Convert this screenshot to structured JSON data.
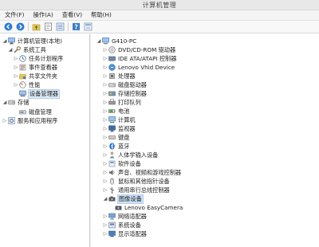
{
  "window": {
    "title": "计算机管理"
  },
  "menu": [
    "文件(F)",
    "操作(A)",
    "查看(V)",
    "帮助(H)"
  ],
  "toolbar": [
    "back-icon",
    "forward-icon",
    "up-folder-icon",
    "properties-icon",
    "list-view-icon",
    "help-icon",
    "details-view-icon"
  ],
  "left_tree": [
    {
      "label": "计算机管理(本地)",
      "icon": "computer-icon",
      "level": 0,
      "expanded": true
    },
    {
      "label": "系统工具",
      "icon": "tools-icon",
      "level": 1,
      "expanded": true
    },
    {
      "label": "任务计划程序",
      "icon": "task-scheduler-icon",
      "level": 2,
      "expanded": false
    },
    {
      "label": "事件查看器",
      "icon": "event-viewer-icon",
      "level": 2,
      "expanded": false
    },
    {
      "label": "共享文件夹",
      "icon": "shared-folder-icon",
      "level": 2,
      "expanded": false
    },
    {
      "label": "性能",
      "icon": "performance-icon",
      "level": 2,
      "expanded": false
    },
    {
      "label": "设备管理器",
      "icon": "device-manager-icon",
      "level": 2,
      "selected": true
    },
    {
      "label": "存储",
      "icon": "storage-icon",
      "level": 1,
      "expanded": true
    },
    {
      "label": "磁盘管理",
      "icon": "disk-icon",
      "level": 2
    },
    {
      "label": "服务和应用程序",
      "icon": "services-icon",
      "level": 1,
      "expanded": false
    }
  ],
  "device_tree": {
    "root": "G410-PC",
    "categories": [
      {
        "label": "DVD/CD-ROM 驱动器",
        "icon": "dvd-icon"
      },
      {
        "label": "IDE ATA/ATAPI 控制器",
        "icon": "ide-controller-icon"
      },
      {
        "label": "Lenovo Vhid Device",
        "icon": "lenovo-device-icon"
      },
      {
        "label": "处理器",
        "icon": "processor-icon"
      },
      {
        "label": "磁盘驱动器",
        "icon": "disk-drive-icon"
      },
      {
        "label": "存储控制器",
        "icon": "storage-controller-icon"
      },
      {
        "label": "打印队列",
        "icon": "printer-icon"
      },
      {
        "label": "电池",
        "icon": "battery-icon"
      },
      {
        "label": "计算机",
        "icon": "computer-icon"
      },
      {
        "label": "监视器",
        "icon": "monitor-icon"
      },
      {
        "label": "键盘",
        "icon": "keyboard-icon"
      },
      {
        "label": "蓝牙",
        "icon": "bluetooth-icon"
      },
      {
        "label": "人体学输入设备",
        "icon": "hid-icon"
      },
      {
        "label": "软件设备",
        "icon": "software-device-icon"
      },
      {
        "label": "声音、视频和游戏控制器",
        "icon": "sound-icon"
      },
      {
        "label": "鼠标和其他指针设备",
        "icon": "mouse-icon"
      },
      {
        "label": "通用串行总线控制器",
        "icon": "usb-icon"
      },
      {
        "label": "图像设备",
        "icon": "camera-icon",
        "expanded": true,
        "selected": true,
        "children": [
          {
            "label": "Lenovo EasyCamera",
            "icon": "camera-icon"
          }
        ]
      },
      {
        "label": "网络适配器",
        "icon": "network-adapter-icon"
      },
      {
        "label": "系统设备",
        "icon": "system-device-icon"
      },
      {
        "label": "显示适配器",
        "icon": "display-adapter-icon"
      }
    ]
  },
  "colors": {
    "accent": "#3c7fc4",
    "selection": "#dbe9f7",
    "titlebar": "#e8e8e8"
  }
}
